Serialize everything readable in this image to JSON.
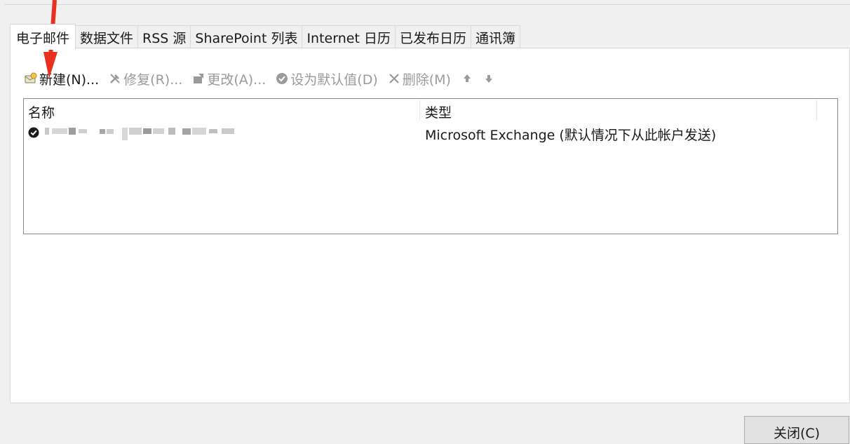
{
  "tabs": [
    {
      "label": "电子邮件",
      "active": true
    },
    {
      "label": "数据文件",
      "active": false
    },
    {
      "label": "RSS 源",
      "active": false
    },
    {
      "label": "SharePoint 列表",
      "active": false
    },
    {
      "label": "Internet 日历",
      "active": false
    },
    {
      "label": "已发布日历",
      "active": false
    },
    {
      "label": "通讯簿",
      "active": false
    }
  ],
  "toolbar": {
    "new_label": "新建(N)...",
    "repair_label": "修复(R)...",
    "change_label": "更改(A)...",
    "default_label": "设为默认值(D)",
    "delete_label": "删除(M)",
    "new_icon": "new-account-icon",
    "repair_icon": "tools-icon",
    "change_icon": "change-icon",
    "default_icon": "check-circle-icon",
    "delete_icon": "x-icon"
  },
  "list": {
    "headers": {
      "name": "名称",
      "type": "类型"
    },
    "rows": [
      {
        "type": "Microsoft Exchange (默认情况下从此帐户发送)",
        "is_default": true
      }
    ]
  },
  "footer": {
    "close_label": "关闭(C)"
  },
  "colors": {
    "arrow": "#e8321f",
    "panel": "#ffffff",
    "background": "#f0f0f0",
    "disabled_text": "#9a9a9a"
  }
}
